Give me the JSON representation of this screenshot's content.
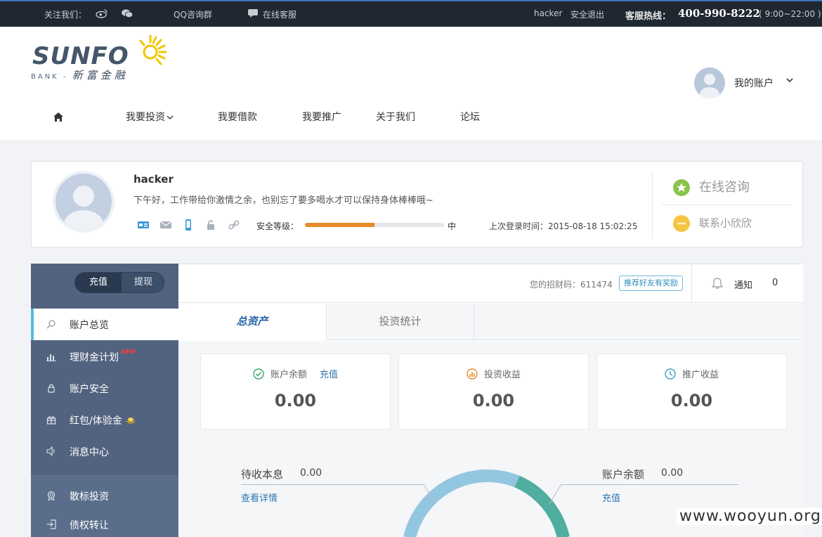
{
  "topbar": {
    "follow_label": "关注我们：",
    "qq_group": "QQ咨询群",
    "online_service": "在线客服",
    "username": "hacker",
    "logout": "安全退出",
    "hotline_label": "客服热线：",
    "hotline_number": "400-990-8222",
    "hotline_hours": "( 9:00~22:00 )"
  },
  "logo": {
    "word": "SUNFO",
    "sub_en": "BANK",
    "sub_cn": "新富金融"
  },
  "account": {
    "label": "我的账户"
  },
  "nav": {
    "items": [
      "我要投资",
      "我要借款",
      "我要推广",
      "关于我们",
      "论坛"
    ]
  },
  "profile": {
    "name": "hacker",
    "greeting": "下午好，工作带给你激情之余，也别忘了要多喝水才可以保持身体棒棒哦~",
    "security_label": "安全等级：",
    "security_level": "中",
    "security_progress": 0.5,
    "last_login": "上次登录时间：2015-08-18 15:02:25",
    "online_consult": "在线咨询",
    "contact": "联系小欣欣"
  },
  "sidebar": {
    "recharge": "充值",
    "withdraw": "提现",
    "items": [
      "账户总览",
      "理财金计划",
      "账户安全",
      "红包/体验金",
      "消息中心",
      "散标投资",
      "债权转让"
    ],
    "new_badge": "NEW"
  },
  "main": {
    "invite_label": "您的招财码：611474",
    "invite_button": "推荐好友有奖励",
    "notice_label": "通知",
    "notice_count": "0",
    "tabs": [
      "总资产",
      "投资统计"
    ],
    "cards": [
      {
        "label": "账户余额",
        "link": "充值",
        "value": "0.00"
      },
      {
        "label": "投资收益",
        "value": "0.00"
      },
      {
        "label": "推广收益",
        "value": "0.00"
      }
    ],
    "pending_label": "待收本息",
    "pending_value": "0.00",
    "pending_link": "查看详情",
    "balance_label": "账户余额",
    "balance_value": "0.00",
    "balance_link": "充值"
  },
  "watermark": "www.wooyun.org"
}
